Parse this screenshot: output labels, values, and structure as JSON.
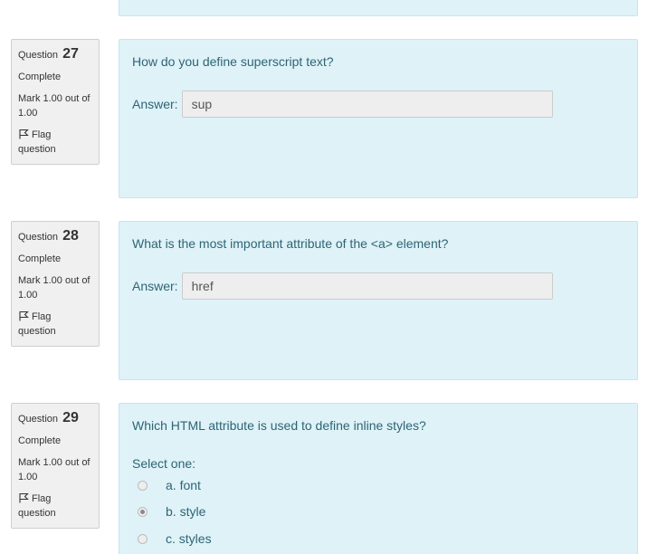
{
  "labels": {
    "question_prefix": "Question",
    "answer": "Answer:",
    "select_one": "Select one:",
    "flag": "Flag question"
  },
  "questions": [
    {
      "number": "27",
      "state": "Complete",
      "grade": "Mark 1.00 out of 1.00",
      "text": "How do you define superscript text?",
      "answer": "sup"
    },
    {
      "number": "28",
      "state": "Complete",
      "grade": "Mark 1.00 out of 1.00",
      "text": "What is the most important attribute of the <a> element?",
      "answer": "href"
    },
    {
      "number": "29",
      "state": "Complete",
      "grade": "Mark 1.00 out of 1.00",
      "text": "Which HTML attribute is used to define inline styles?",
      "options": [
        {
          "label": "a. font",
          "checked": false
        },
        {
          "label": "b. style",
          "checked": true
        },
        {
          "label": "c. styles",
          "checked": false
        }
      ]
    }
  ],
  "colors": {
    "content_bg": "#def2f8",
    "content_border": "#c5e6f0",
    "text": "#2f6473",
    "info_bg": "#f0f0f0"
  },
  "icons": {
    "flag": "flag-icon"
  }
}
